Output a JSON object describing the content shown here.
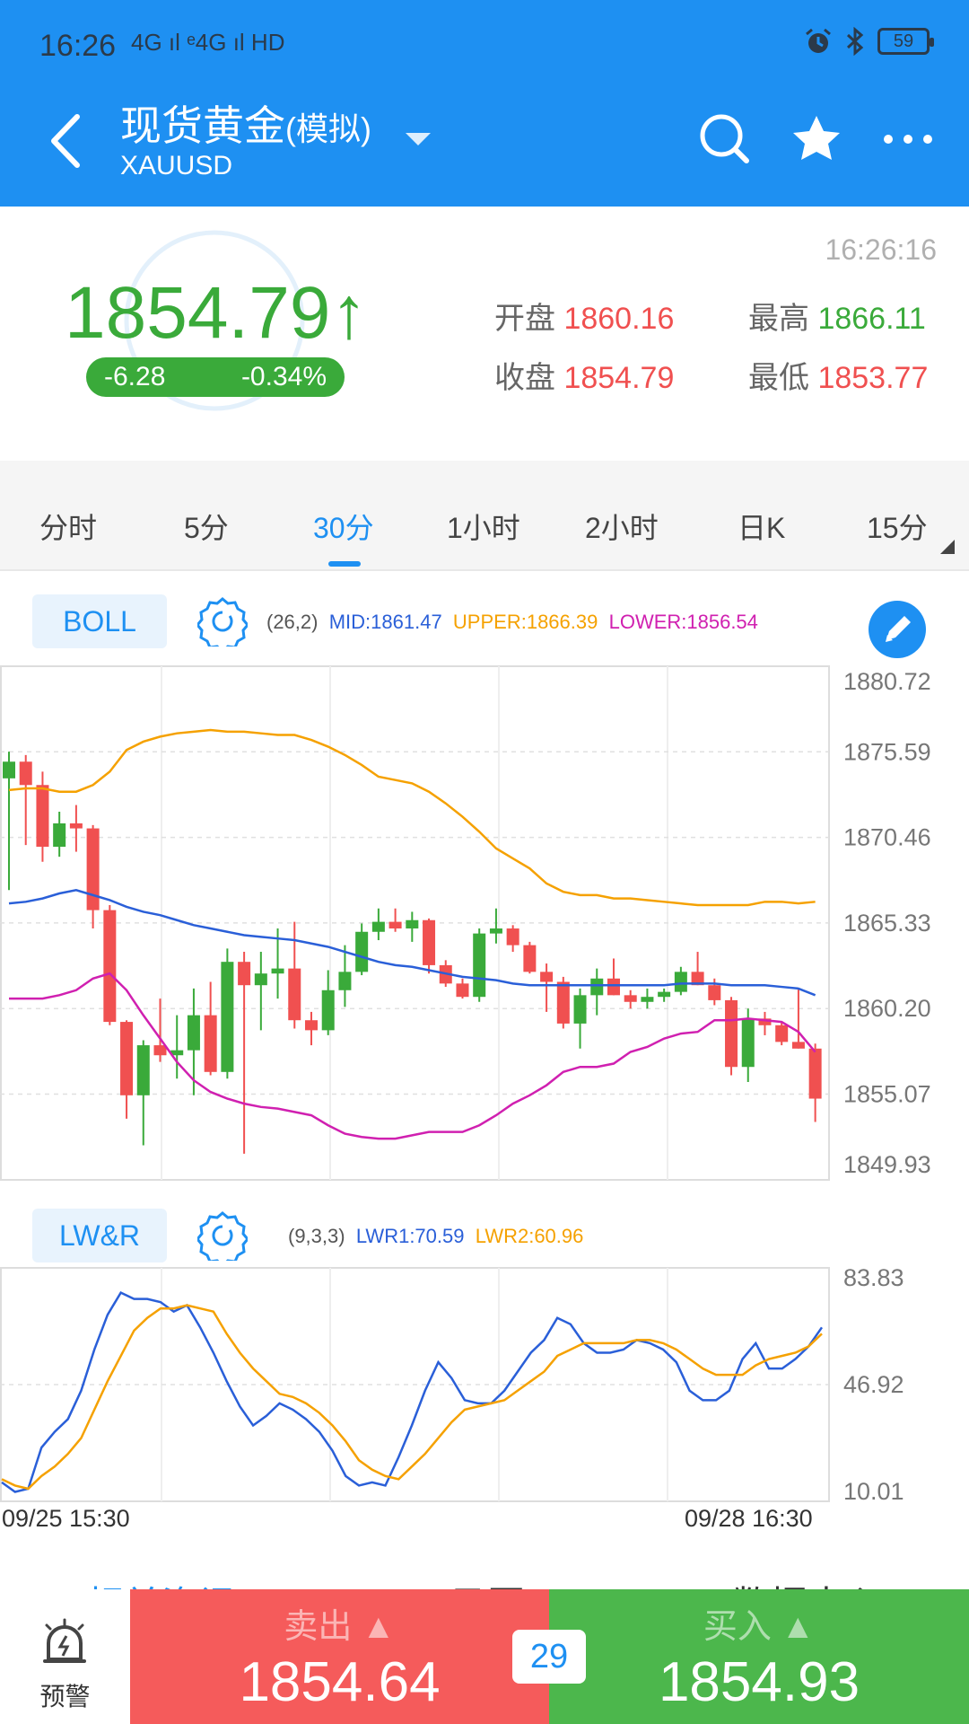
{
  "status_bar": {
    "time": "16:26",
    "network": "4G ıl ᵉ4G ıl HD",
    "battery": "59"
  },
  "header": {
    "title": "现货黄金",
    "title_suffix": "(模拟)",
    "symbol": "XAUUSD"
  },
  "price": {
    "current": "1854.79",
    "arrow": "↑",
    "change": "-6.28",
    "change_pct": "-0.34%",
    "updated_time": "16:26:16",
    "open_label": "开盘",
    "open": "1860.16",
    "high_label": "最高",
    "high": "1866.11",
    "close_label": "收盘",
    "close": "1854.79",
    "low_label": "最低",
    "low": "1853.77"
  },
  "tabs": [
    {
      "label": "分时"
    },
    {
      "label": "5分"
    },
    {
      "label": "30分"
    },
    {
      "label": "1小时"
    },
    {
      "label": "2小时"
    },
    {
      "label": "日K"
    },
    {
      "label": "15分"
    }
  ],
  "active_tab": "30分",
  "boll": {
    "name": "BOLL",
    "params": "(26,2)",
    "mid": "MID:1861.47",
    "upper": "UPPER:1866.39",
    "lower": "LOWER:1856.54"
  },
  "lwr": {
    "name": "LW&R",
    "params": "(9,3,3)",
    "lwr1": "LWR1:70.59",
    "lwr2": "LWR2:60.96"
  },
  "colors": {
    "blue": "#1e90f2",
    "up_green": "#3aaa3a",
    "down_red": "#f05050",
    "boll_mid": "#2a5fd8",
    "boll_upper": "#f5a100",
    "boll_lower": "#d020b0"
  },
  "chart_data": [
    {
      "type": "candlestick",
      "y_ticks": [
        "1880.72",
        "1875.59",
        "1870.46",
        "1865.33",
        "1860.20",
        "1855.07",
        "1849.93"
      ],
      "ylim": [
        1849.93,
        1880.72
      ],
      "candles": [
        {
          "o": 1874.0,
          "h": 1875.6,
          "l": 1867.3,
          "c": 1875.0
        },
        {
          "o": 1875.0,
          "h": 1875.4,
          "l": 1870.0,
          "c": 1873.6
        },
        {
          "o": 1873.6,
          "h": 1874.4,
          "l": 1869.0,
          "c": 1869.9
        },
        {
          "o": 1869.9,
          "h": 1872.0,
          "l": 1869.3,
          "c": 1871.3
        },
        {
          "o": 1871.3,
          "h": 1872.4,
          "l": 1869.6,
          "c": 1871.0
        },
        {
          "o": 1871.0,
          "h": 1871.2,
          "l": 1865.0,
          "c": 1866.1
        },
        {
          "o": 1866.1,
          "h": 1866.4,
          "l": 1859.2,
          "c": 1859.4
        },
        {
          "o": 1859.4,
          "h": 1859.5,
          "l": 1853.6,
          "c": 1855.0
        },
        {
          "o": 1855.0,
          "h": 1858.3,
          "l": 1852.0,
          "c": 1858.0
        },
        {
          "o": 1858.0,
          "h": 1860.8,
          "l": 1857.0,
          "c": 1857.4
        },
        {
          "o": 1857.4,
          "h": 1859.8,
          "l": 1856.0,
          "c": 1857.7
        },
        {
          "o": 1857.7,
          "h": 1861.4,
          "l": 1855.0,
          "c": 1859.8
        },
        {
          "o": 1859.8,
          "h": 1861.8,
          "l": 1856.2,
          "c": 1856.4
        },
        {
          "o": 1856.4,
          "h": 1863.8,
          "l": 1856.0,
          "c": 1863.0
        },
        {
          "o": 1863.0,
          "h": 1863.6,
          "l": 1851.5,
          "c": 1861.6
        },
        {
          "o": 1861.6,
          "h": 1863.6,
          "l": 1858.9,
          "c": 1862.3
        },
        {
          "o": 1862.3,
          "h": 1865.0,
          "l": 1860.8,
          "c": 1862.6
        },
        {
          "o": 1862.6,
          "h": 1865.4,
          "l": 1859.0,
          "c": 1859.5
        },
        {
          "o": 1859.5,
          "h": 1860.0,
          "l": 1858.0,
          "c": 1858.9
        },
        {
          "o": 1858.9,
          "h": 1862.5,
          "l": 1858.6,
          "c": 1861.3
        },
        {
          "o": 1861.3,
          "h": 1864.0,
          "l": 1860.3,
          "c": 1862.4
        },
        {
          "o": 1862.4,
          "h": 1865.3,
          "l": 1862.2,
          "c": 1864.8
        },
        {
          "o": 1864.8,
          "h": 1866.2,
          "l": 1864.3,
          "c": 1865.4
        },
        {
          "o": 1865.4,
          "h": 1866.2,
          "l": 1864.8,
          "c": 1865.0
        },
        {
          "o": 1865.0,
          "h": 1866.0,
          "l": 1864.2,
          "c": 1865.5
        },
        {
          "o": 1865.5,
          "h": 1865.6,
          "l": 1862.3,
          "c": 1862.8
        },
        {
          "o": 1862.8,
          "h": 1863.1,
          "l": 1861.5,
          "c": 1861.7
        },
        {
          "o": 1861.7,
          "h": 1862.0,
          "l": 1860.8,
          "c": 1860.9
        },
        {
          "o": 1860.9,
          "h": 1865.0,
          "l": 1860.6,
          "c": 1864.7
        },
        {
          "o": 1864.7,
          "h": 1866.2,
          "l": 1864.1,
          "c": 1865.0
        },
        {
          "o": 1865.0,
          "h": 1865.2,
          "l": 1863.6,
          "c": 1864.0
        },
        {
          "o": 1864.0,
          "h": 1864.2,
          "l": 1862.3,
          "c": 1862.4
        },
        {
          "o": 1862.4,
          "h": 1862.9,
          "l": 1860.0,
          "c": 1861.8
        },
        {
          "o": 1861.8,
          "h": 1862.1,
          "l": 1859.0,
          "c": 1859.3
        },
        {
          "o": 1859.3,
          "h": 1861.4,
          "l": 1857.8,
          "c": 1861.0
        },
        {
          "o": 1861.0,
          "h": 1862.6,
          "l": 1859.8,
          "c": 1862.0
        },
        {
          "o": 1862.0,
          "h": 1863.2,
          "l": 1861.0,
          "c": 1861.0
        },
        {
          "o": 1861.0,
          "h": 1861.3,
          "l": 1860.2,
          "c": 1860.6
        },
        {
          "o": 1860.6,
          "h": 1861.4,
          "l": 1860.2,
          "c": 1860.9
        },
        {
          "o": 1860.9,
          "h": 1861.4,
          "l": 1860.6,
          "c": 1861.2
        },
        {
          "o": 1861.2,
          "h": 1862.7,
          "l": 1861.0,
          "c": 1862.4
        },
        {
          "o": 1862.4,
          "h": 1863.6,
          "l": 1861.6,
          "c": 1861.6
        },
        {
          "o": 1861.6,
          "h": 1862.0,
          "l": 1860.4,
          "c": 1860.7
        },
        {
          "o": 1860.7,
          "h": 1860.9,
          "l": 1856.2,
          "c": 1856.7
        },
        {
          "o": 1856.7,
          "h": 1860.2,
          "l": 1855.8,
          "c": 1859.6
        },
        {
          "o": 1859.6,
          "h": 1860.0,
          "l": 1858.6,
          "c": 1859.2
        },
        {
          "o": 1859.2,
          "h": 1859.4,
          "l": 1858.0,
          "c": 1858.2
        },
        {
          "o": 1858.2,
          "h": 1861.4,
          "l": 1857.8,
          "c": 1857.8
        },
        {
          "o": 1857.8,
          "h": 1858.1,
          "l": 1853.4,
          "c": 1854.8
        }
      ],
      "mid": [
        1866.5,
        1866.6,
        1866.8,
        1867.1,
        1867.3,
        1867.0,
        1866.7,
        1866.3,
        1866.0,
        1865.8,
        1865.5,
        1865.2,
        1865.0,
        1864.8,
        1864.6,
        1864.5,
        1864.4,
        1864.3,
        1864.1,
        1863.9,
        1863.6,
        1863.3,
        1863.0,
        1862.8,
        1862.7,
        1862.5,
        1862.3,
        1862.1,
        1862.0,
        1861.9,
        1861.7,
        1861.6,
        1861.6,
        1861.6,
        1861.6,
        1861.6,
        1861.6,
        1861.6,
        1861.6,
        1861.6,
        1861.7,
        1861.7,
        1861.7,
        1861.6,
        1861.6,
        1861.6,
        1861.5,
        1861.4,
        1861.0
      ],
      "upper": [
        1873.3,
        1873.4,
        1873.4,
        1873.2,
        1873.2,
        1873.6,
        1874.4,
        1875.7,
        1876.2,
        1876.5,
        1876.7,
        1876.8,
        1876.9,
        1876.8,
        1876.8,
        1876.7,
        1876.6,
        1876.6,
        1876.3,
        1875.9,
        1875.4,
        1874.8,
        1874.1,
        1873.9,
        1873.7,
        1873.2,
        1872.5,
        1871.7,
        1870.8,
        1869.8,
        1869.2,
        1868.6,
        1867.7,
        1867.2,
        1867.0,
        1867.0,
        1866.8,
        1866.8,
        1866.7,
        1866.6,
        1866.5,
        1866.4,
        1866.4,
        1866.4,
        1866.4,
        1866.6,
        1866.6,
        1866.5,
        1866.6
      ],
      "lower": [
        1860.8,
        1860.8,
        1860.8,
        1861.0,
        1861.3,
        1862.0,
        1862.3,
        1861.3,
        1859.8,
        1858.4,
        1857.0,
        1855.9,
        1855.2,
        1854.8,
        1854.5,
        1854.3,
        1854.2,
        1854.0,
        1853.8,
        1853.2,
        1852.7,
        1852.5,
        1852.4,
        1852.4,
        1852.6,
        1852.8,
        1852.8,
        1852.8,
        1853.2,
        1853.8,
        1854.5,
        1855.0,
        1855.6,
        1856.4,
        1856.7,
        1856.7,
        1856.9,
        1857.6,
        1857.9,
        1858.4,
        1858.7,
        1858.8,
        1859.5,
        1859.5,
        1859.6,
        1859.5,
        1859.4,
        1858.8,
        1857.6
      ],
      "x_labels": [
        "09/25 15:30",
        "09/28 16:30"
      ]
    },
    {
      "type": "line",
      "y_ticks": [
        "83.83",
        "46.92",
        "10.01"
      ],
      "ylim": [
        10.01,
        83.83
      ],
      "series": [
        {
          "name": "LWR1",
          "color": "#2a5fd8",
          "values": [
            16,
            13,
            14,
            27,
            32,
            36,
            45,
            58,
            69,
            76,
            74,
            74,
            73,
            70,
            72,
            65,
            57,
            48,
            40,
            34,
            37,
            41,
            39,
            36,
            32,
            26,
            18,
            15,
            16,
            15,
            24,
            34,
            45,
            54,
            49,
            42,
            41,
            41,
            45,
            51,
            57,
            61,
            68,
            66,
            60,
            57,
            57,
            58,
            61,
            60,
            58,
            54,
            45,
            42,
            42,
            45,
            55,
            60,
            52,
            52,
            55,
            59,
            65
          ]
        },
        {
          "name": "LWR2",
          "color": "#f5a100",
          "values": [
            17,
            15,
            14,
            18,
            21,
            25,
            30,
            39,
            48,
            56,
            64,
            68,
            71,
            71,
            72,
            71,
            70,
            63,
            57,
            52,
            48,
            44,
            43,
            41,
            38,
            34,
            29,
            23,
            20,
            18,
            17,
            21,
            25,
            30,
            35,
            39,
            40,
            41,
            42,
            45,
            48,
            51,
            56,
            58,
            60,
            60,
            60,
            60,
            61,
            61,
            60,
            58,
            55,
            52,
            50,
            50,
            50,
            53,
            55,
            56,
            57,
            59,
            63
          ]
        }
      ],
      "x_labels": [
        "09/25 15:30",
        "09/28 16:30"
      ]
    }
  ],
  "bottom_tabs": [
    "相关资讯",
    "日历",
    "数据中心"
  ],
  "bottom": {
    "alert_label": "预警",
    "sell_label": "卖出",
    "sell_price": "1854.64",
    "spread": "29",
    "buy_label": "买入",
    "buy_price": "1854.93"
  }
}
